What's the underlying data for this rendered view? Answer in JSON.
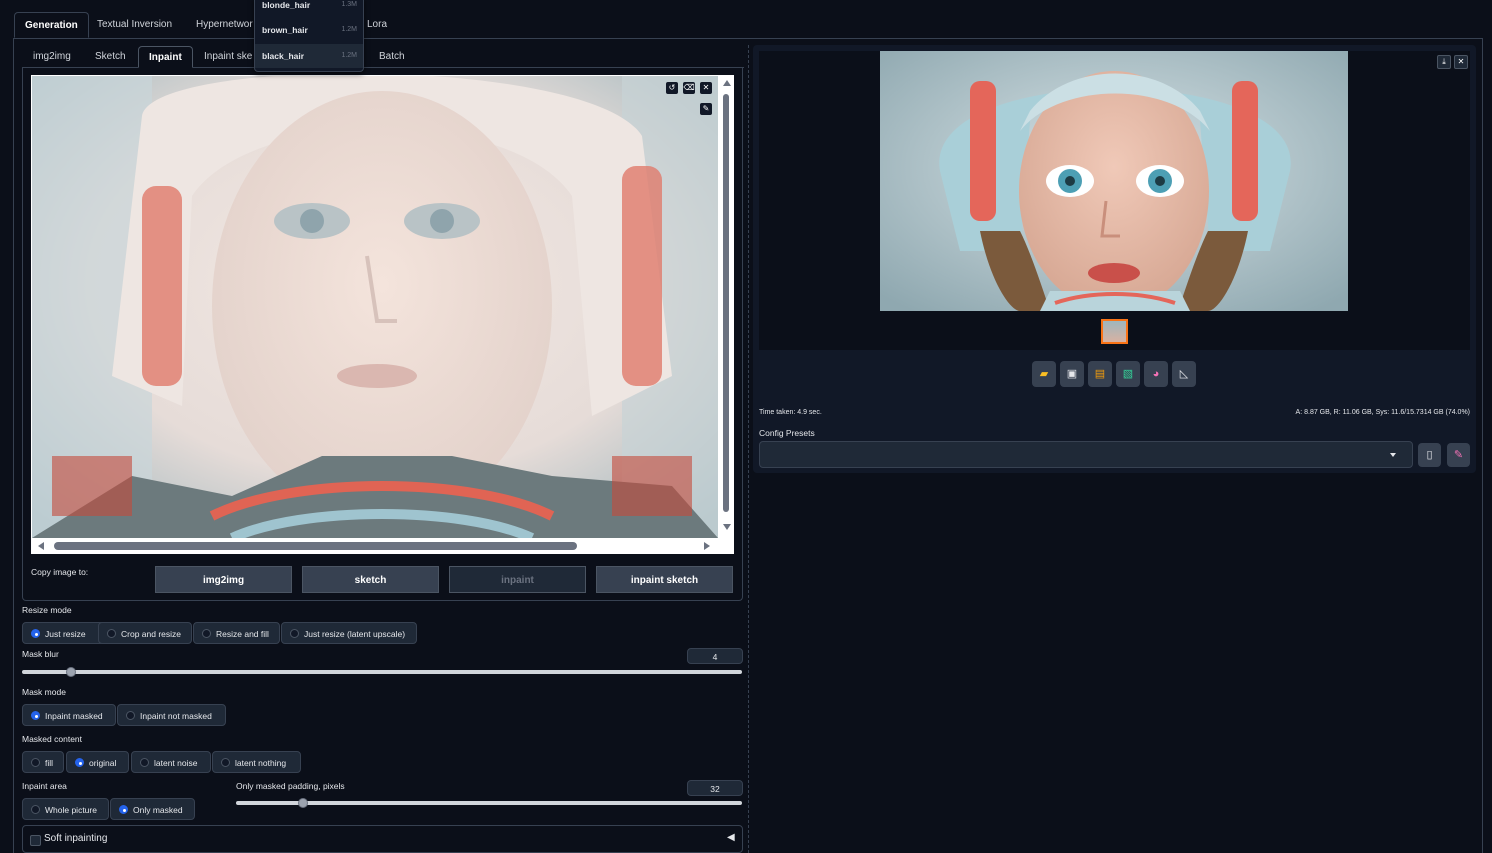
{
  "top_tabs": [
    {
      "label": "Generation",
      "active": true
    },
    {
      "label": "Textual Inversion",
      "active": false
    },
    {
      "label": "Hypernetwor",
      "active": false
    },
    {
      "label": "Lora",
      "active": false
    }
  ],
  "dropdown": {
    "items": [
      {
        "label": "blonde_hair",
        "size": "1.3M"
      },
      {
        "label": "brown_hair",
        "size": "1.2M"
      },
      {
        "label": "black_hair",
        "size": "1.2M"
      }
    ]
  },
  "sub_tabs": [
    {
      "label": "img2img",
      "active": false
    },
    {
      "label": "Sketch",
      "active": false
    },
    {
      "label": "Inpaint",
      "active": true
    },
    {
      "label": "Inpaint ske",
      "active": false
    },
    {
      "label": "Batch",
      "active": false
    }
  ],
  "copy_image": {
    "label": "Copy image to:",
    "buttons": [
      {
        "label": "img2img",
        "enabled": true
      },
      {
        "label": "sketch",
        "enabled": true
      },
      {
        "label": "inpaint",
        "enabled": false
      },
      {
        "label": "inpaint sketch",
        "enabled": true
      }
    ]
  },
  "resize_mode": {
    "label": "Resize mode",
    "options": [
      {
        "label": "Just resize",
        "selected": true
      },
      {
        "label": "Crop and resize",
        "selected": false
      },
      {
        "label": "Resize and fill",
        "selected": false
      },
      {
        "label": "Just resize (latent upscale)",
        "selected": false
      }
    ]
  },
  "mask_blur": {
    "label": "Mask blur",
    "value": "4",
    "fraction": 0.06
  },
  "mask_mode": {
    "label": "Mask mode",
    "options": [
      {
        "label": "Inpaint masked",
        "selected": true
      },
      {
        "label": "Inpaint not masked",
        "selected": false
      }
    ]
  },
  "masked_content": {
    "label": "Masked content",
    "options": [
      {
        "label": "fill",
        "selected": false
      },
      {
        "label": "original",
        "selected": true
      },
      {
        "label": "latent noise",
        "selected": false
      },
      {
        "label": "latent nothing",
        "selected": false
      }
    ]
  },
  "inpaint_area": {
    "label": "Inpaint area",
    "options": [
      {
        "label": "Whole picture",
        "selected": false
      },
      {
        "label": "Only masked",
        "selected": true
      }
    ]
  },
  "padding": {
    "label": "Only masked padding, pixels",
    "value": "32",
    "fraction": 0.13
  },
  "soft_inpainting": {
    "label": "Soft inpainting",
    "arrow": "◀"
  },
  "result": {
    "time_taken": "Time taken: 4.9 sec.",
    "vram": "A: 8.87 GB, R: 11.06 GB, Sys: 11.6/15.7314 GB (74.0%)",
    "config_label": "Config Presets"
  },
  "colors": {
    "accent": "#f97316",
    "radio": "#2563eb",
    "bg": "#0b0f19"
  }
}
